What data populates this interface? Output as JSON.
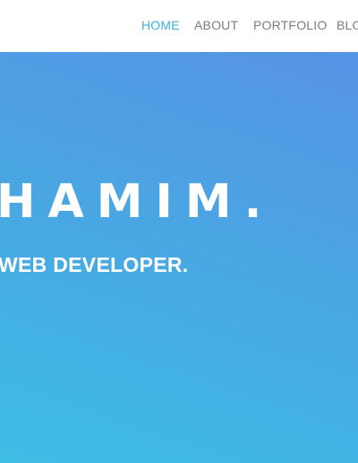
{
  "nav": {
    "items": [
      {
        "label": "HOME",
        "active": true
      },
      {
        "label": "ABOUT",
        "active": false
      },
      {
        "label": "PORTFOLIO",
        "active": false
      },
      {
        "label": "BLO",
        "active": false
      }
    ],
    "active_color": "#3bb0e2",
    "inactive_color": "#7d7d7d"
  },
  "hero": {
    "title": "HAMIM.",
    "subtitle": "WEB DEVELOPER.",
    "gradient_top_color": "#5693e4",
    "gradient_bottom_color": "#3dbde4",
    "text_color": "#ffffff"
  }
}
